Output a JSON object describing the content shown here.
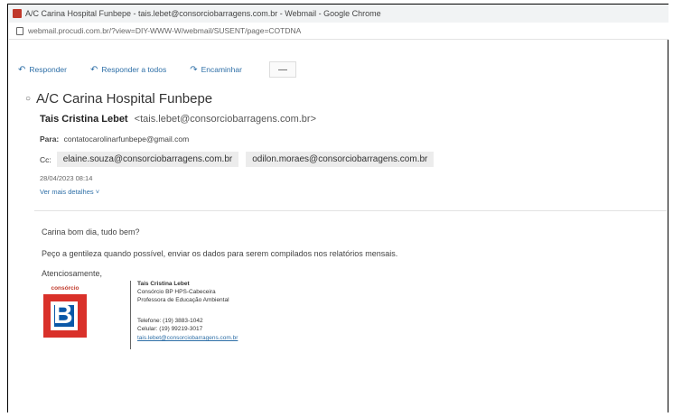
{
  "window": {
    "title": "A/C Carina Hospital Funbepe - tais.lebet@consorciobarragens.com.br - Webmail - Google Chrome",
    "url": "webmail.procudi.com.br/?view=DIY-WWW-W/webmail/SUSENT/page=COTDNA"
  },
  "toolbar": {
    "reply": "Responder",
    "reply_all": "Responder a todos",
    "forward": "Encaminhar",
    "more": "—"
  },
  "email": {
    "subject": "A/C Carina Hospital Funbepe",
    "sender_name": "Tais Cristina Lebet",
    "sender_email": "<tais.lebet@consorciobarragens.com.br>",
    "to_label": "Para:",
    "to_value": "contatocarolinarfunbepe@gmail.com",
    "cc_label": "Cc:",
    "cc": [
      "elaine.souza@consorciobarragens.com.br",
      "odilon.moraes@consorciobarragens.com.br"
    ],
    "date": "28/04/2023 08:14",
    "more_details": "Ver mais detalhes"
  },
  "body": {
    "greeting": "Carina bom dia, tudo bem?",
    "message": "Peço a gentileza quando possível, enviar os dados para serem compilados nos relatórios mensais.",
    "closing": "Atenciosamente,"
  },
  "signature": {
    "logo_text": "consórcio",
    "name": "Tais Cristina Lebet",
    "line1": "Consórcio BP HPS-Cabeceira",
    "line2": "Professora de Educação Ambiental",
    "phone": "Telefone: (19) 3883-1042",
    "cell": "Celular:  (19) 99219-3017",
    "email": "tais.lebet@consorciobarragens.com.br"
  },
  "colors": {
    "link": "#2e6fa7",
    "logo_red": "#d9312a",
    "logo_blue": "#0a58a8"
  }
}
